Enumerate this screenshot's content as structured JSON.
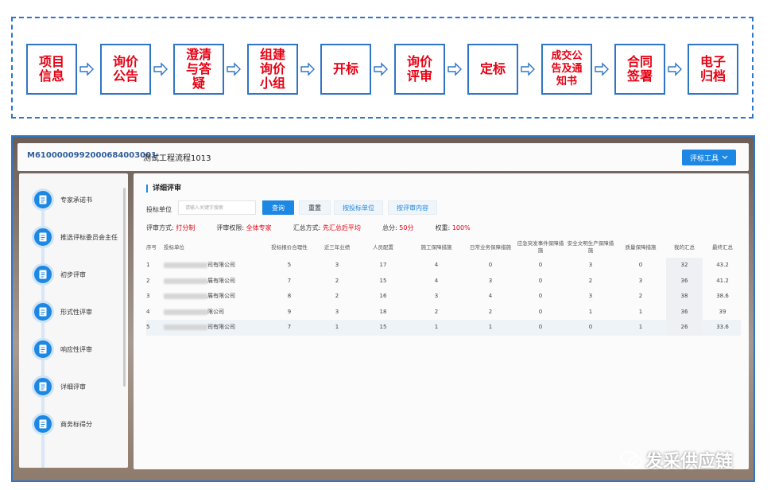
{
  "flow": {
    "steps": [
      "项目\n信息",
      "询价\n公告",
      "澄清\n与答\n疑",
      "组建\n询价\n小组",
      "开标",
      "询价\n评审",
      "定标",
      "成交公\n告及通\n知书",
      "合同\n签署",
      "电子\n归档"
    ],
    "colors": {
      "border": "#2e75c8",
      "text": "#e60012"
    }
  },
  "app": {
    "project_code": "M6100000992000684003001",
    "project_name": "测试工程流程1013",
    "tool_button": "评标工具",
    "sidebar": [
      "专家承诺书",
      "推选评标委员会主任",
      "初步评审",
      "形式性评审",
      "响应性评审",
      "详细评审",
      "商务标得分"
    ],
    "main": {
      "title": "详细评审",
      "filter_label": "投标单位",
      "search_placeholder": "请输入关键字搜索",
      "query_btn": "查询",
      "reset_btn": "重置",
      "by_bidder_btn": "按投标单位",
      "by_content_btn": "按评审内容",
      "method_label": "评审方式:",
      "method_value": "打分制",
      "authority_label": "评审权限:",
      "authority_value": "全体专家",
      "summary_label": "汇总方式:",
      "summary_value": "先汇总后平均",
      "total_label": "总分:",
      "total_value": "50分",
      "weight_label": "权重:",
      "weight_value": "100%"
    },
    "table": {
      "headers": [
        "序号",
        "投标单位",
        "投标报价合理性",
        "近三年业绩",
        "人员配置",
        "施工保障措施",
        "日常业务保障措施",
        "应急突发事件保障措施",
        "安全文明生产保障措施",
        "质量保障措施",
        "我的汇总",
        "最终汇总"
      ],
      "rows": [
        [
          "1",
          "司有限公司",
          "5",
          "3",
          "17",
          "4",
          "0",
          "0",
          "3",
          "0",
          "32",
          "43.2"
        ],
        [
          "2",
          "展有限公司",
          "7",
          "2",
          "15",
          "4",
          "3",
          "0",
          "2",
          "3",
          "36",
          "41.2"
        ],
        [
          "3",
          "展有限公司",
          "8",
          "2",
          "16",
          "3",
          "4",
          "0",
          "3",
          "2",
          "38",
          "38.6"
        ],
        [
          "4",
          "限公司",
          "9",
          "3",
          "18",
          "2",
          "2",
          "0",
          "1",
          "1",
          "36",
          "39"
        ],
        [
          "5",
          "司有限公司",
          "7",
          "1",
          "15",
          "1",
          "1",
          "0",
          "0",
          "1",
          "26",
          "33.6"
        ]
      ]
    }
  },
  "watermark": "发采供应链"
}
